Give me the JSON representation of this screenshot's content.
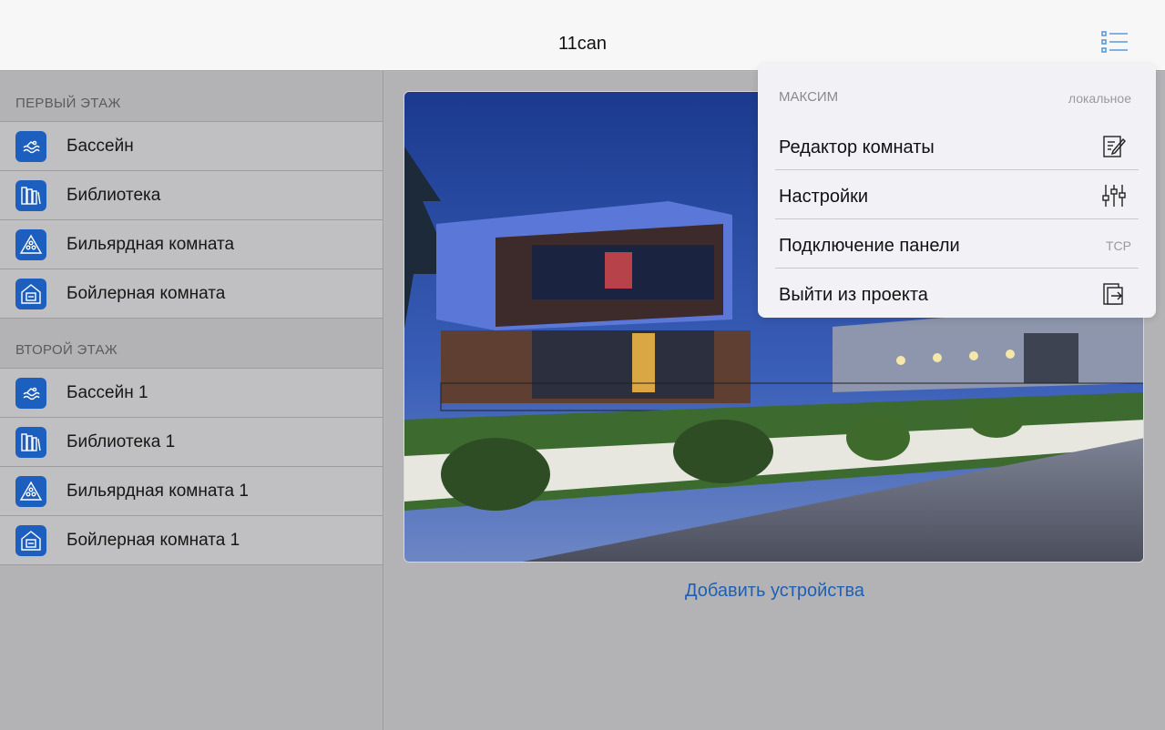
{
  "header": {
    "title": "11can",
    "menu_icon": "list-menu-icon"
  },
  "sidebar": {
    "sections": [
      {
        "title": "ПЕРВЫЙ ЭТАЖ",
        "rooms": [
          {
            "label": "Бассейн",
            "icon": "pool-icon"
          },
          {
            "label": "Библиотека",
            "icon": "library-icon"
          },
          {
            "label": "Бильярдная комната",
            "icon": "billiard-icon"
          },
          {
            "label": "Бойлерная комната",
            "icon": "boiler-icon"
          }
        ]
      },
      {
        "title": "ВТОРОЙ ЭТАЖ",
        "rooms": [
          {
            "label": "Бассейн 1",
            "icon": "pool-icon"
          },
          {
            "label": "Библиотека 1",
            "icon": "library-icon"
          },
          {
            "label": "Бильярдная комната 1",
            "icon": "billiard-icon"
          },
          {
            "label": "Бойлерная комната 1",
            "icon": "boiler-icon"
          }
        ]
      }
    ]
  },
  "main": {
    "image": "house-exterior-night-photo",
    "add_devices_label": "Добавить устройства"
  },
  "menu": {
    "user": "МАКСИМ",
    "connection": "локальное",
    "items": [
      {
        "label": "Редактор комнаты",
        "icon": "edit-note-icon"
      },
      {
        "label": "Настройки",
        "icon": "sliders-icon"
      },
      {
        "label": "Подключение панели",
        "tag": "TCP"
      },
      {
        "label": "Выйти из проекта",
        "icon": "exit-icon"
      }
    ]
  },
  "colors": {
    "accent": "#1f5fb4",
    "icon_bg": "#1d5fbf",
    "header_bg": "#f7f7f7",
    "popover_bg": "#f2f1f6"
  }
}
